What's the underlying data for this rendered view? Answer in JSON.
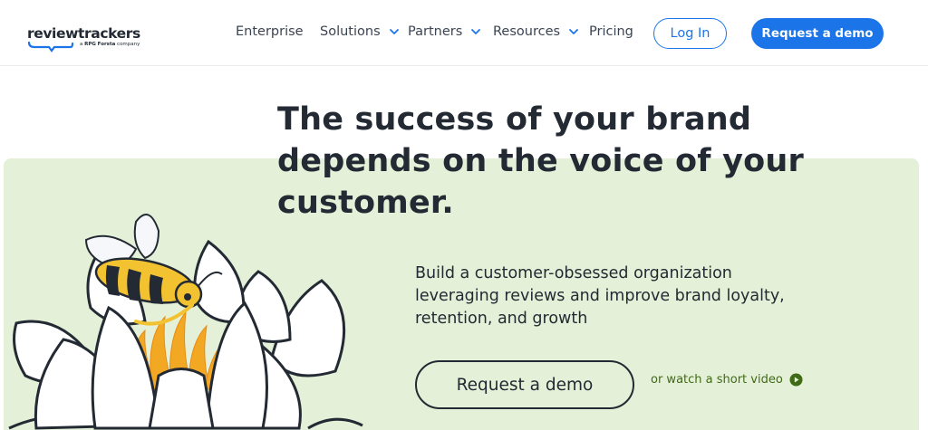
{
  "brand": {
    "name": "reviewtrackers",
    "tagline": "a ",
    "tagline_company": "Forsta",
    "tagline_suffix": " company",
    "tagline_prefix_mark": "G",
    "tagline_mark": "RPG",
    "accent_color": "#1b75e8",
    "hero_bg": "#e5f0d8",
    "link_color": "#3f6a16"
  },
  "nav": {
    "items": [
      {
        "label": "Enterprise",
        "has_dropdown": false
      },
      {
        "label": "Solutions",
        "has_dropdown": true
      },
      {
        "label": "Partners",
        "has_dropdown": true
      },
      {
        "label": "Resources",
        "has_dropdown": true
      },
      {
        "label": "Pricing",
        "has_dropdown": false
      }
    ],
    "login_label": "Log In",
    "demo_label": "Request a demo"
  },
  "hero": {
    "headline_line1": "The success of your brand",
    "headline_line2": "depends on the voice of your",
    "headline_line3": "customer.",
    "sub_line1": "Build a customer-obsessed organization",
    "sub_line2": "leveraging reviews and improve brand loyalty,",
    "sub_line3": "retention, and growth",
    "cta_label": "Request a demo",
    "video_link_label": "or watch a short video",
    "video_icon": "play-circle-icon",
    "illustration": "bee-on-water-lily"
  }
}
